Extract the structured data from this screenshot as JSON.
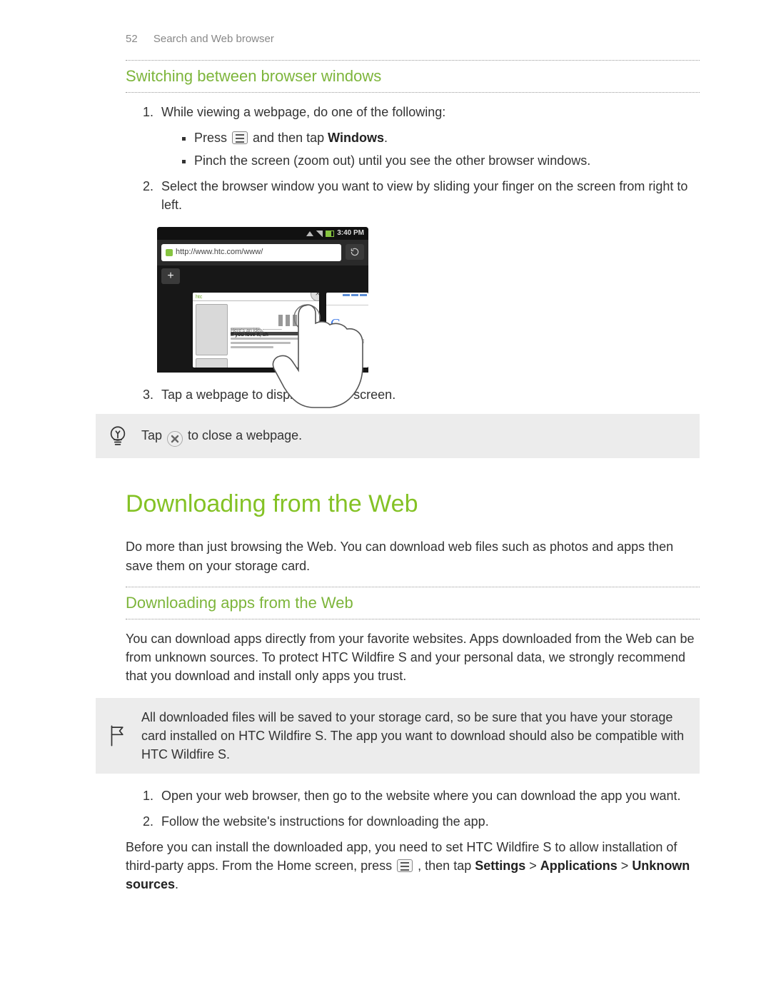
{
  "header": {
    "page_num": "52",
    "section": "Search and Web browser"
  },
  "subheads": {
    "switching": "Switching between browser windows",
    "dl_apps": "Downloading apps from the Web"
  },
  "h1": "Downloading from the Web",
  "steps_switch": {
    "s1_intro": "While viewing a webpage, do one of the following:",
    "b1_pre": "Press ",
    "b1_post": " and then tap ",
    "b1_bold": "Windows",
    "b1_end": ".",
    "b2": "Pinch the screen (zoom out) until you see the other browser windows.",
    "s2": "Select the browser window you want to view by sliding your finger on the screen from right to left.",
    "s3": "Tap a webpage to display it in full screen."
  },
  "phone_shot": {
    "time": "3:40 PM",
    "url": "http://www.htc.com/www/",
    "card_head": "htc",
    "card_tag1": "Here's an idea:",
    "card_tag2": "If you love it, sh",
    "google_g": "G"
  },
  "tip": {
    "pre": "Tap ",
    "post": " to close a webpage."
  },
  "dl_intro": "Do more than just browsing the Web. You can download web files such as photos and apps then save them on your storage card.",
  "dl_apps_p": "You can download apps directly from your favorite websites. Apps downloaded from the Web can be from unknown sources. To protect HTC Wildfire S and your personal data, we strongly recommend that you download and install only apps you trust.",
  "note_box": "All downloaded files will be saved to your storage card, so be sure that you have your storage card installed on HTC Wildfire S. The app you want to download should also be compatible with HTC Wildfire S.",
  "dl_steps": {
    "s1": "Open your web browser, then go to the website where you can download the app you want.",
    "s2": "Follow the website's instructions for downloading the app."
  },
  "install_para": {
    "pre": "Before you can install the downloaded app, you need to set HTC Wildfire S to allow installation of third-party apps. From the Home screen, press ",
    "post1": " , then tap ",
    "b1": "Settings",
    "gt1": " > ",
    "b2": "Applications",
    "gt2": " > ",
    "b3": "Unknown sources",
    "end": "."
  }
}
